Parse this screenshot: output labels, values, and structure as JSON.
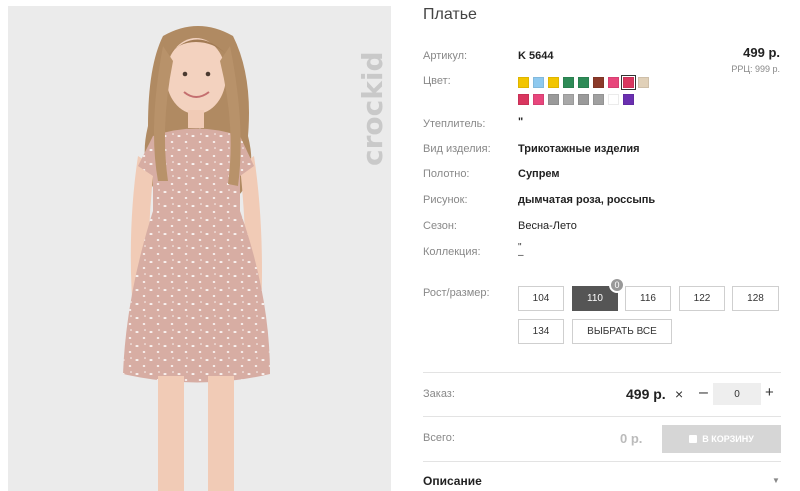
{
  "product": {
    "title": "Платье",
    "image_alt": "Девочка в розовом платье"
  },
  "brand_watermark": "crockid",
  "details": [
    {
      "label": "Артикул:",
      "value": "K 5644",
      "bold": true
    },
    {
      "label": "Цвет:",
      "value": "",
      "bold": false
    },
    {
      "label": "Утеплитель:",
      "value": "\"",
      "bold": true
    },
    {
      "label": "Вид изделия:",
      "value": "Трикотажные изделия",
      "bold": true
    },
    {
      "label": "Полотно:",
      "value": "Супрем",
      "bold": true
    },
    {
      "label": "Рисунок:",
      "value": "дымчатая роза, россыпь",
      "bold": true
    },
    {
      "label": "Сезон:",
      "value": "Весна-Лето",
      "bold": false
    },
    {
      "label": "Коллекция:",
      "value": "\"",
      "bold": false
    }
  ],
  "collection_extra": "–",
  "price": "499 р.",
  "rrp": "РРЦ: 999 р.",
  "colors": {
    "row1": [
      "#f2c500",
      "#8ec9ef",
      "#f2c500",
      "#2e8b57",
      "#2e8b57",
      "#8b3a2a",
      "#e8467c",
      "#d9365f",
      "#e0d0b8"
    ],
    "row2": [
      "#d9365f",
      "#e8467c",
      "#9a9a9a",
      "#a8a8a8",
      "#9a9a9a",
      "#a0a0a0",
      "#ffffff",
      "#6a2fb0"
    ],
    "selected_index": 7
  },
  "size": {
    "label": "Рост/размер:",
    "options": [
      "104",
      "110",
      "116",
      "122",
      "128",
      "134"
    ],
    "selected": "110",
    "selected_count": "0",
    "select_all": "ВЫБРАТЬ ВСЕ"
  },
  "order": {
    "label": "Заказ:",
    "price": "499 р.",
    "times": "×",
    "minus": "–",
    "quantity": "0",
    "plus": "+"
  },
  "total": {
    "label": "Всего:",
    "value": "0 р.",
    "cart_button": "В КОРЗИНУ"
  },
  "description": {
    "label": "Описание",
    "caret": "▼"
  }
}
